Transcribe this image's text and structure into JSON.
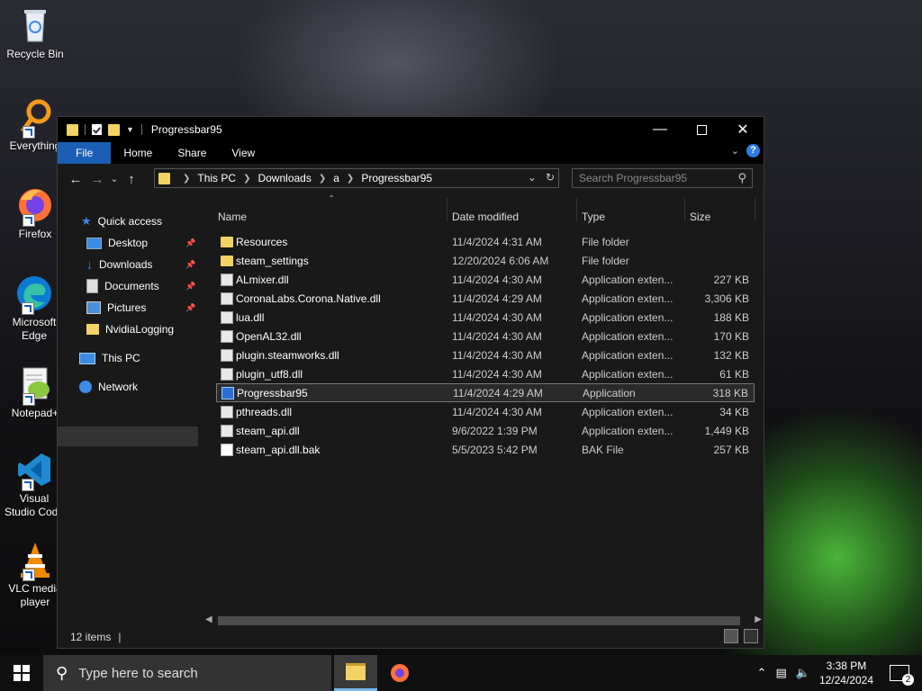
{
  "desktop": {
    "icons": [
      {
        "label": "Recycle Bin"
      },
      {
        "label": "Everything"
      },
      {
        "label": "Firefox"
      },
      {
        "label": "Microsoft Edge"
      },
      {
        "label": "Notepad+"
      },
      {
        "label": "Visual Studio Code"
      },
      {
        "label": "VLC media player"
      }
    ]
  },
  "window": {
    "title": "Progressbar95",
    "ribbon_tabs": [
      "File",
      "Home",
      "Share",
      "View"
    ],
    "address": {
      "crumbs": [
        "This PC",
        "Downloads",
        "a",
        "Progressbar95"
      ]
    },
    "search": {
      "placeholder": "Search Progressbar95"
    },
    "nav": {
      "quick_access": "Quick access",
      "items": [
        "Desktop",
        "Downloads",
        "Documents",
        "Pictures",
        "NvidiaLogging"
      ],
      "this_pc": "This PC",
      "network": "Network"
    },
    "columns": {
      "name": "Name",
      "date": "Date modified",
      "type": "Type",
      "size": "Size"
    },
    "files": [
      {
        "name": "Resources",
        "date": "11/4/2024 4:31 AM",
        "type": "File folder",
        "size": "",
        "icon": "folder-icon"
      },
      {
        "name": "steam_settings",
        "date": "12/20/2024 6:06 AM",
        "type": "File folder",
        "size": "",
        "icon": "folder-icon"
      },
      {
        "name": "ALmixer.dll",
        "date": "11/4/2024 4:30 AM",
        "type": "Application exten...",
        "size": "227 KB",
        "icon": "dll-icon"
      },
      {
        "name": "CoronaLabs.Corona.Native.dll",
        "date": "11/4/2024 4:29 AM",
        "type": "Application exten...",
        "size": "3,306 KB",
        "icon": "dll-icon"
      },
      {
        "name": "lua.dll",
        "date": "11/4/2024 4:30 AM",
        "type": "Application exten...",
        "size": "188 KB",
        "icon": "dll-icon"
      },
      {
        "name": "OpenAL32.dll",
        "date": "11/4/2024 4:30 AM",
        "type": "Application exten...",
        "size": "170 KB",
        "icon": "dll-icon"
      },
      {
        "name": "plugin.steamworks.dll",
        "date": "11/4/2024 4:30 AM",
        "type": "Application exten...",
        "size": "132 KB",
        "icon": "dll-icon"
      },
      {
        "name": "plugin_utf8.dll",
        "date": "11/4/2024 4:30 AM",
        "type": "Application exten...",
        "size": "61 KB",
        "icon": "dll-icon"
      },
      {
        "name": "Progressbar95",
        "date": "11/4/2024 4:29 AM",
        "type": "Application",
        "size": "318 KB",
        "icon": "app-icon",
        "selected": true
      },
      {
        "name": "pthreads.dll",
        "date": "11/4/2024 4:30 AM",
        "type": "Application exten...",
        "size": "34 KB",
        "icon": "dll-icon"
      },
      {
        "name": "steam_api.dll",
        "date": "9/6/2022 1:39 PM",
        "type": "Application exten...",
        "size": "1,449 KB",
        "icon": "dll-icon"
      },
      {
        "name": "steam_api.dll.bak",
        "date": "5/5/2023 5:42 PM",
        "type": "BAK File",
        "size": "257 KB",
        "icon": "file-icon"
      }
    ],
    "status": {
      "count": "12 items"
    }
  },
  "taskbar": {
    "search_placeholder": "Type here to search",
    "time": "3:38 PM",
    "date": "12/24/2024",
    "notifications": "2"
  },
  "colors": {
    "accent": "#1a5fb4",
    "folder": "#f3d266"
  }
}
